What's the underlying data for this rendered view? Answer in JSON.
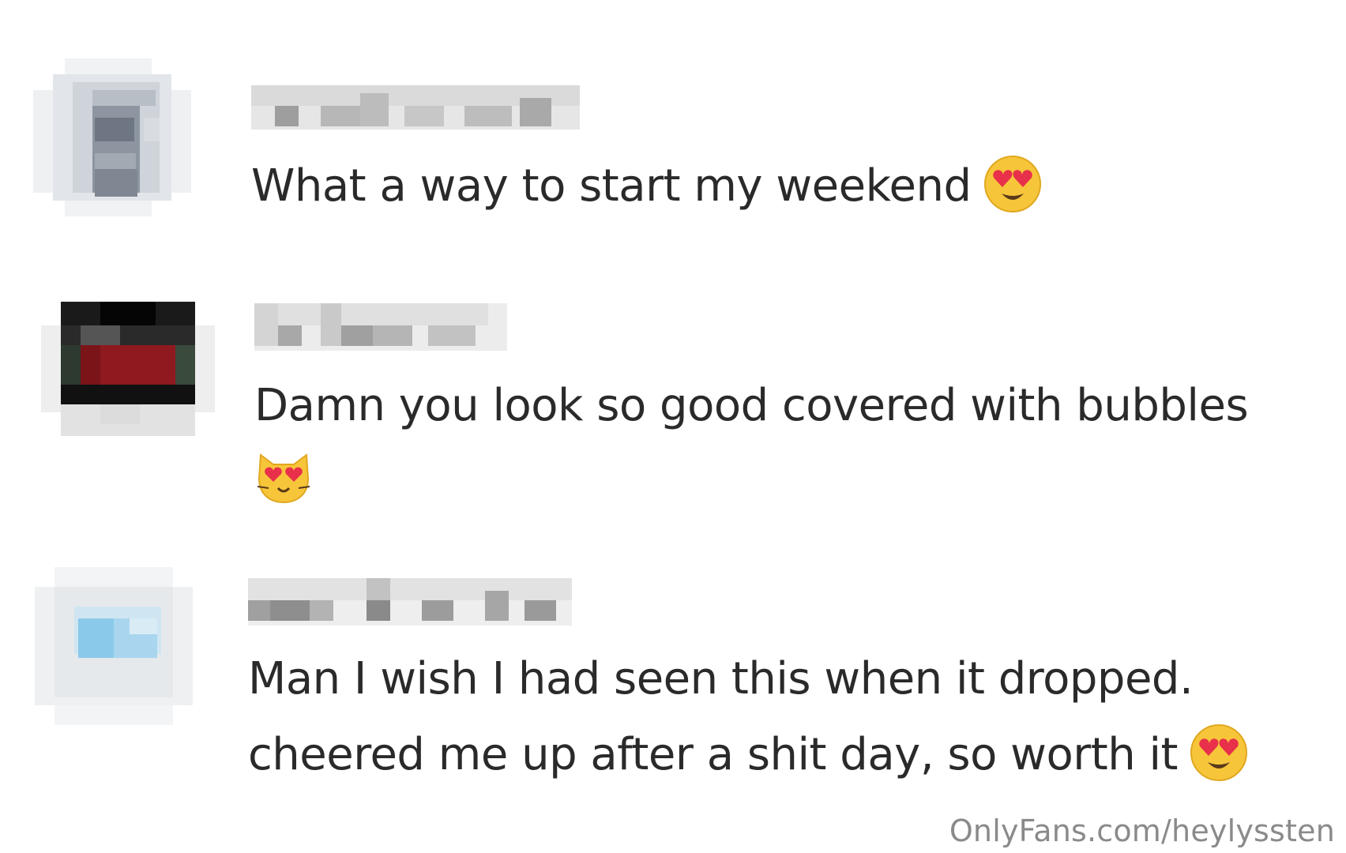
{
  "comments": [
    {
      "text": "What a way to start my weekend",
      "emoji": "heart-eyes-face-icon"
    },
    {
      "text": "Damn you look so good covered with bubbles",
      "emoji": "heart-eyes-cat-icon"
    },
    {
      "line1": "Man I wish I had seen this when it dropped.",
      "line2": "cheered me up after a shit day, so worth it",
      "emoji": "heart-eyes-face-icon"
    }
  ],
  "watermark": "OnlyFans.com/heylyssten",
  "colors": {
    "text": "#2a2a2a",
    "watermark": "#8a8a8a",
    "emoji_face": "#f7c53a",
    "emoji_heart": "#e8304a"
  }
}
